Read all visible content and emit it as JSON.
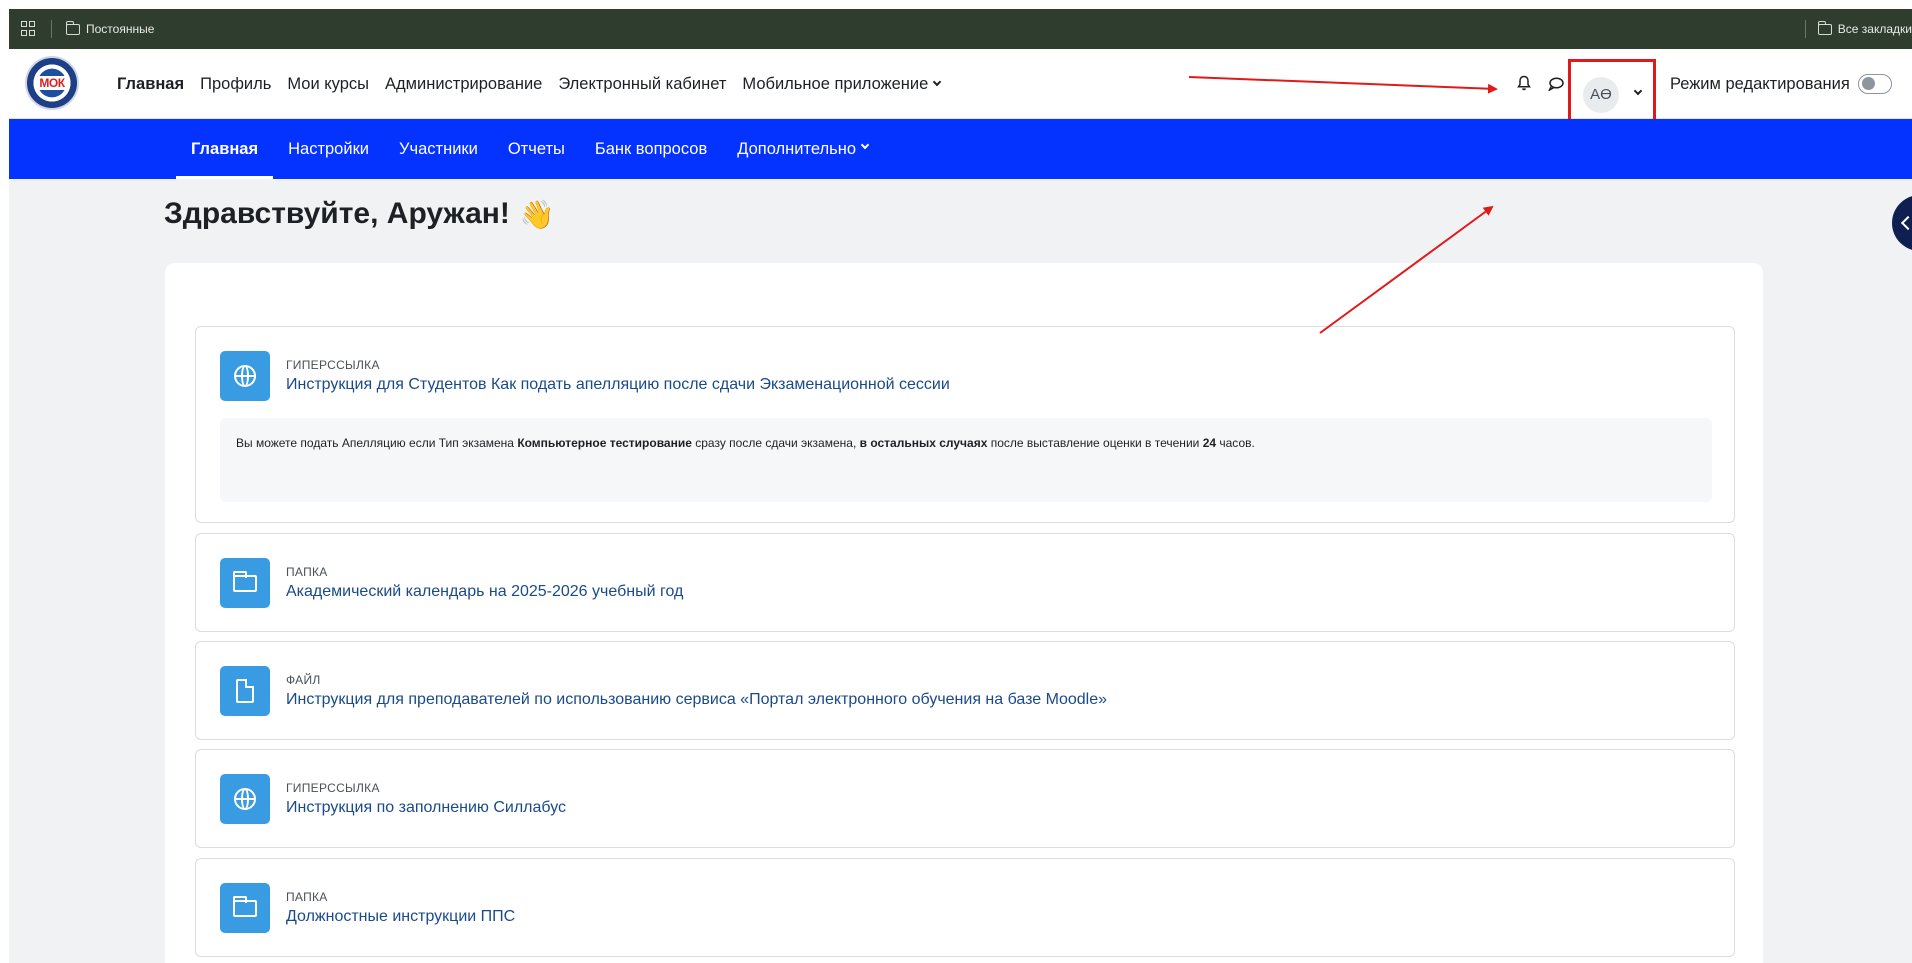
{
  "browser": {
    "bookmark_folder": "Постоянные",
    "all_bookmarks": "Все закладки"
  },
  "navbar": {
    "logo_text": "МОК",
    "items": [
      {
        "label": "Главная",
        "active": true
      },
      {
        "label": "Профиль"
      },
      {
        "label": "Мои курсы"
      },
      {
        "label": "Администрирование"
      },
      {
        "label": "Электронный кабинет"
      },
      {
        "label": "Мобильное приложение"
      }
    ],
    "user_initials": "АӨ",
    "edit_mode_label": "Режим редактирования"
  },
  "secondary_nav": {
    "items": [
      {
        "label": "Главная",
        "active": true
      },
      {
        "label": "Настройки"
      },
      {
        "label": "Участники"
      },
      {
        "label": "Отчеты"
      },
      {
        "label": "Банк вопросов"
      },
      {
        "label": "Дополнительно"
      }
    ]
  },
  "page": {
    "greeting": "Здравствуйте, Аружан!",
    "greeting_emoji": "👋"
  },
  "activities": [
    {
      "type": "ГИПЕРССЫЛКА",
      "icon": "globe-icon",
      "title": "Инструкция для Студентов Как подать апелляцию после сдачи Экзаменационной сессии",
      "description": {
        "part1": "Вы можете подать Апелляцию если Тип экзамена ",
        "bold1": "Компьютерное тестирование",
        "part2": " сразу после сдачи экзамена, ",
        "bold2": "в остальных случаях",
        "part3": " после выставление оценки в течении ",
        "bold3": "24",
        "part4": " часов."
      }
    },
    {
      "type": "ПАПКА",
      "icon": "folder-icon",
      "title": "Академический календарь на 2025-2026 учебный год"
    },
    {
      "type": "ФАЙЛ",
      "icon": "file-icon",
      "title": "Инструкция для преподавателей по использованию сервиса «Портал электронного обучения на базе Moodle»"
    },
    {
      "type": "ГИПЕРССЫЛКА",
      "icon": "globe-icon",
      "title": "Инструкция по заполнению Силлабус"
    },
    {
      "type": "ПАПКА",
      "icon": "folder-icon",
      "title": "Должностные инструкции ППС"
    }
  ],
  "colors": {
    "secondary_nav_bg": "#0433ff",
    "activity_icon_bg": "#399be2",
    "annotation_red": "#e01a1a"
  }
}
